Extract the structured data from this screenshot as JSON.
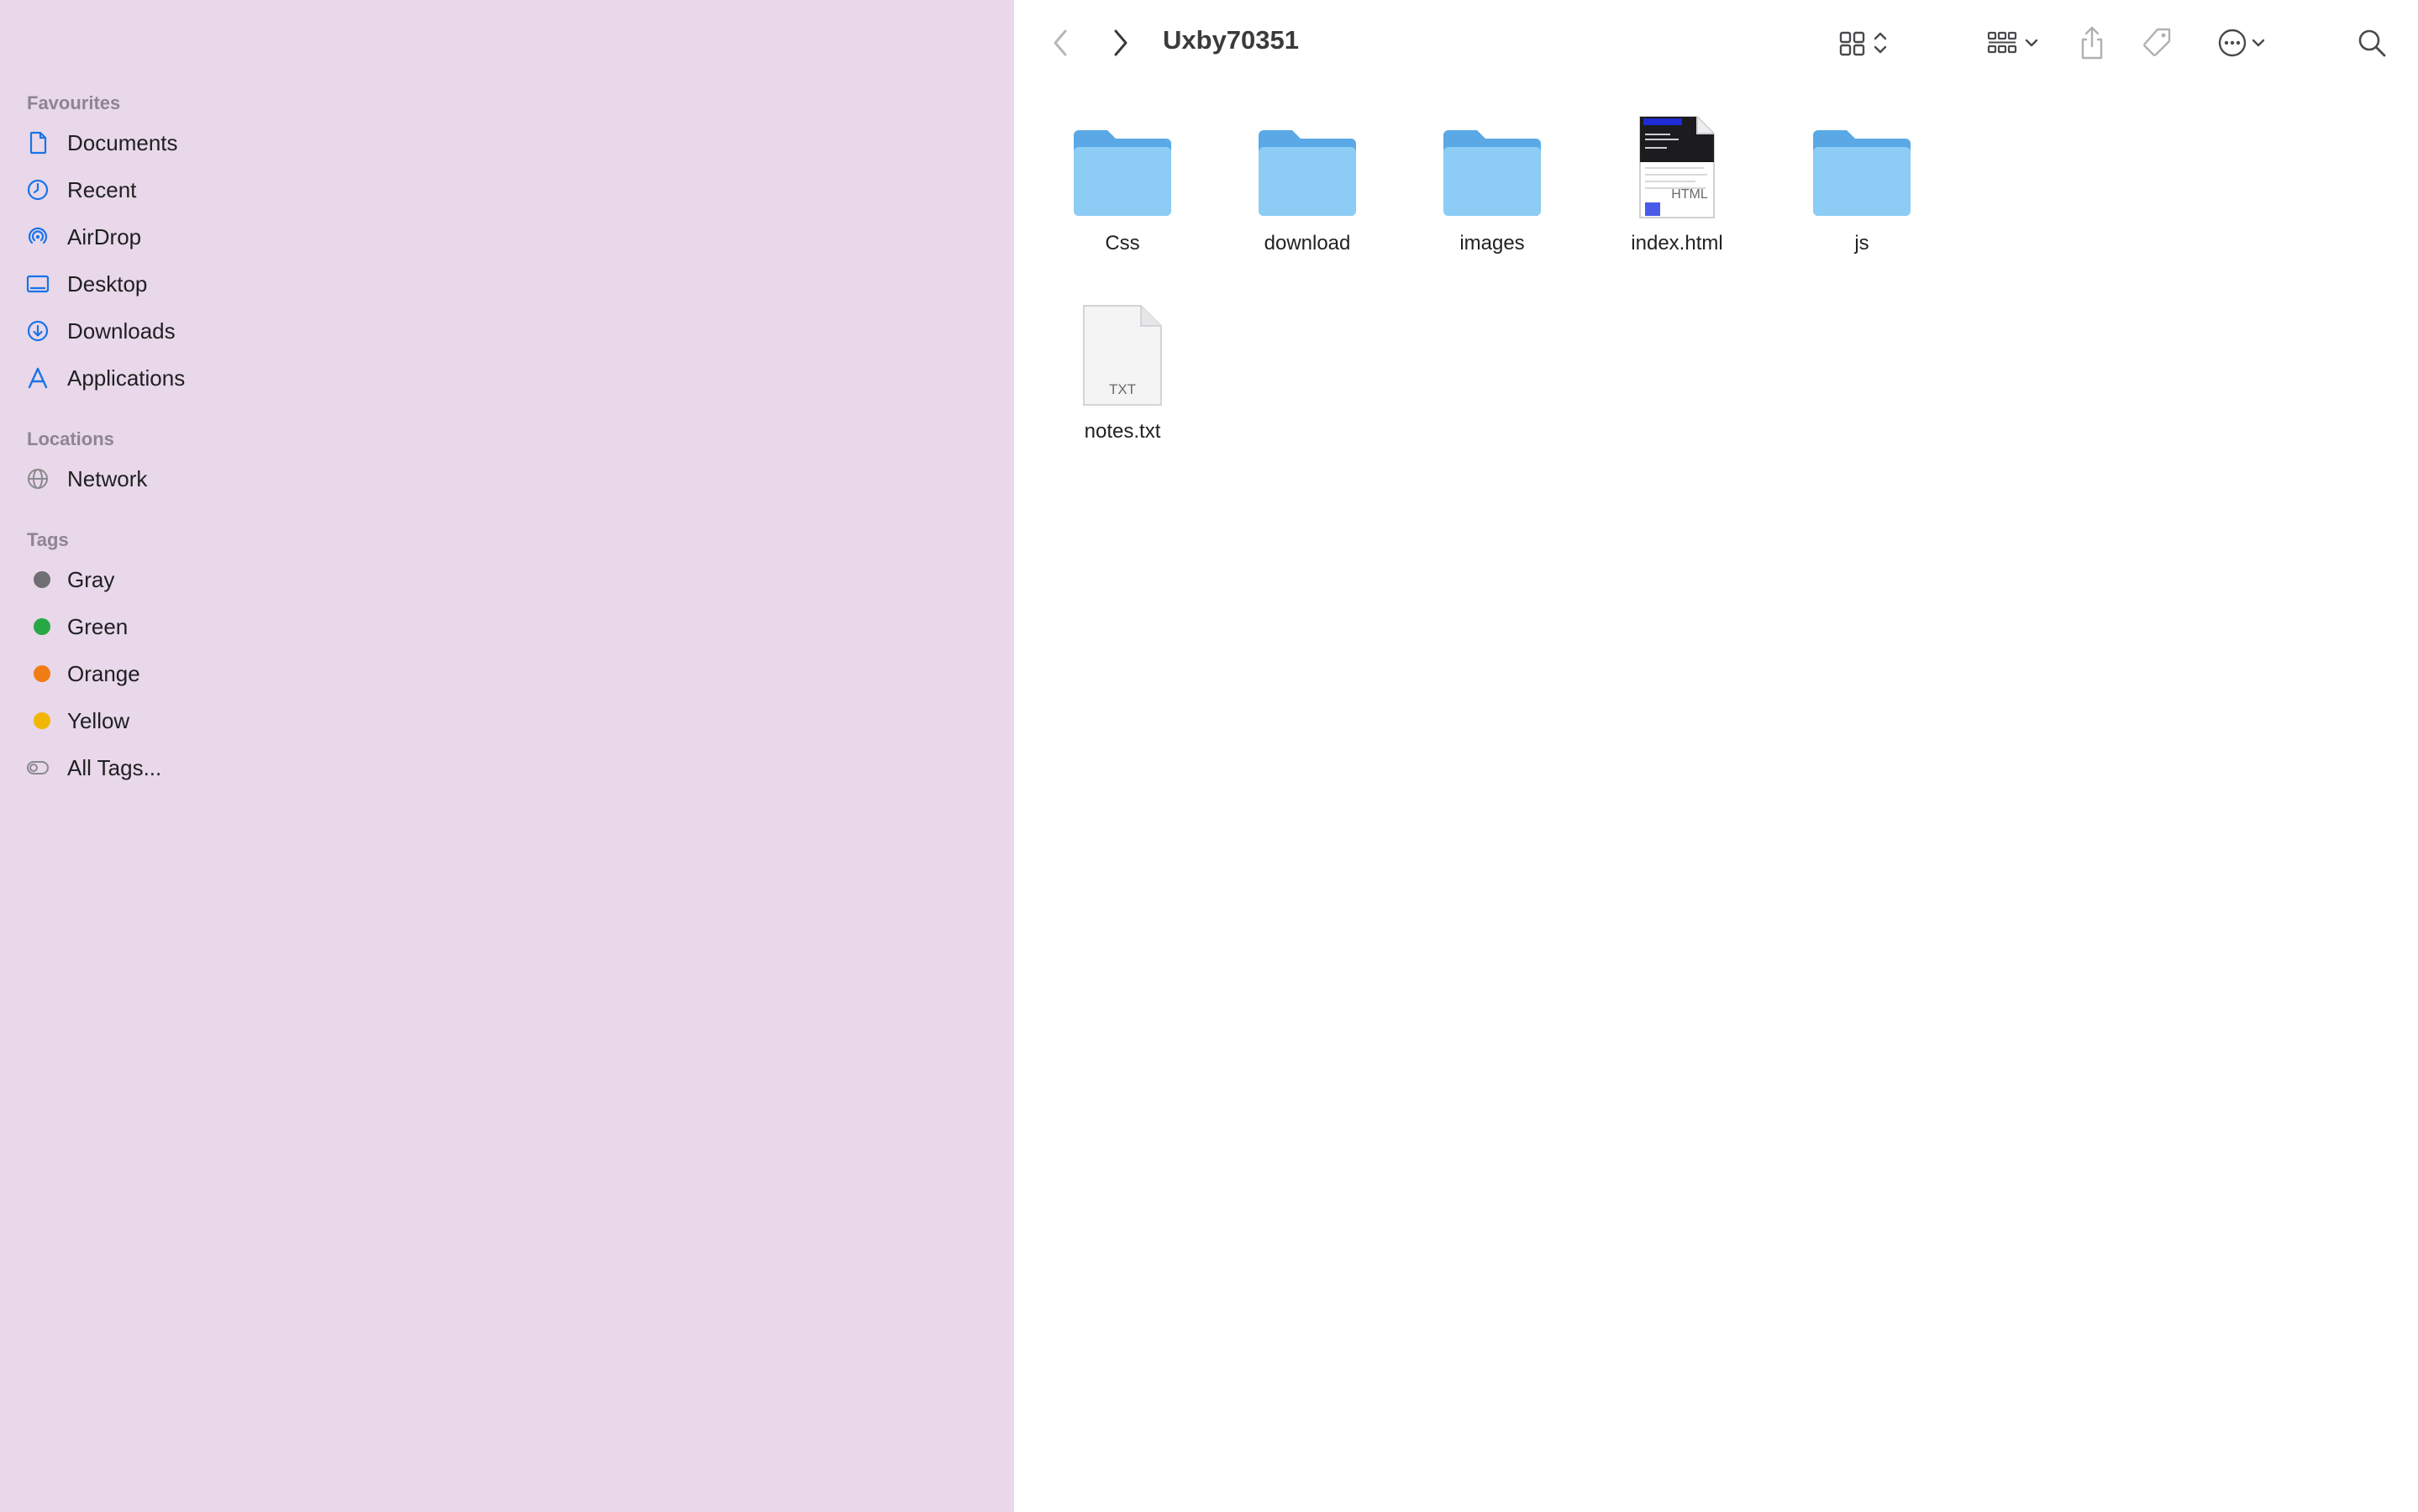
{
  "window": {
    "title": "Uxby70351"
  },
  "sidebar": {
    "favourites_header": "Favourites",
    "favourites": [
      {
        "label": "Documents",
        "icon": "document-icon"
      },
      {
        "label": "Recent",
        "icon": "clock-icon"
      },
      {
        "label": "AirDrop",
        "icon": "airdrop-icon"
      },
      {
        "label": "Desktop",
        "icon": "desktop-icon"
      },
      {
        "label": "Downloads",
        "icon": "download-icon"
      },
      {
        "label": "Applications",
        "icon": "applications-icon"
      }
    ],
    "locations_header": "Locations",
    "locations": [
      {
        "label": "Network",
        "icon": "globe-icon"
      }
    ],
    "tags_header": "Tags",
    "tags": [
      {
        "label": "Gray",
        "color": "#6e6e73"
      },
      {
        "label": "Green",
        "color": "#28a745"
      },
      {
        "label": "Orange",
        "color": "#f07d14"
      },
      {
        "label": "Yellow",
        "color": "#f2b705"
      },
      {
        "label": "All Tags...",
        "icon": "all-tags-icon"
      }
    ]
  },
  "files": [
    {
      "name": "Css",
      "kind": "folder"
    },
    {
      "name": "download",
      "kind": "folder"
    },
    {
      "name": "images",
      "kind": "folder"
    },
    {
      "name": "index.html",
      "kind": "html-document",
      "badge": "HTML"
    },
    {
      "name": "js",
      "kind": "folder"
    },
    {
      "name": "notes.txt",
      "kind": "text-document",
      "badge": "TXT"
    }
  ],
  "colors": {
    "sidebar_bg": "#e8d8e9",
    "accent": "#1a73e8",
    "folder": "#8cccf5"
  }
}
